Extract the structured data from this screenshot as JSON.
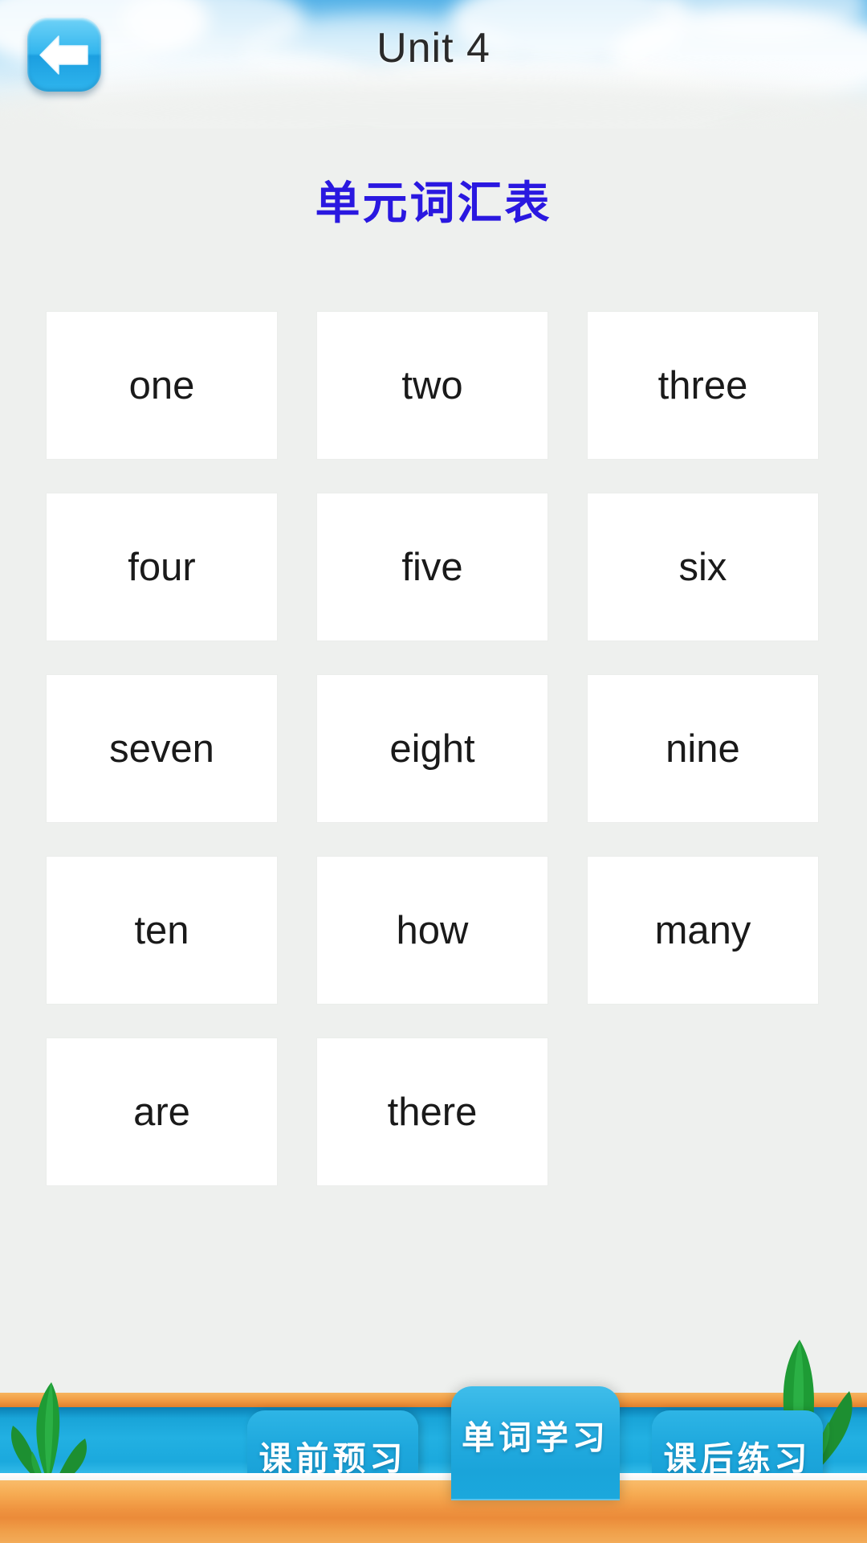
{
  "header": {
    "unit_title": "Unit 4",
    "back_icon": "back-arrow-icon"
  },
  "page": {
    "title": "单元词汇表"
  },
  "vocabulary": {
    "words": [
      "one",
      "two",
      "three",
      "four",
      "five",
      "six",
      "seven",
      "eight",
      "nine",
      "ten",
      "how",
      "many",
      "are",
      "there"
    ]
  },
  "bottom_nav": {
    "tabs": [
      {
        "label": "课前预习",
        "active": false
      },
      {
        "label": "单词学习",
        "active": true
      },
      {
        "label": "课后练习",
        "active": false
      }
    ]
  },
  "colors": {
    "page_bg": "#eef0ee",
    "title_blue": "#2a18e0",
    "tab_blue": "#1ba8dd",
    "ledge_orange": "#ef9440",
    "grass_green": "#1f9b38",
    "card_white": "#ffffff",
    "sky_blue": "#57b3e8"
  }
}
